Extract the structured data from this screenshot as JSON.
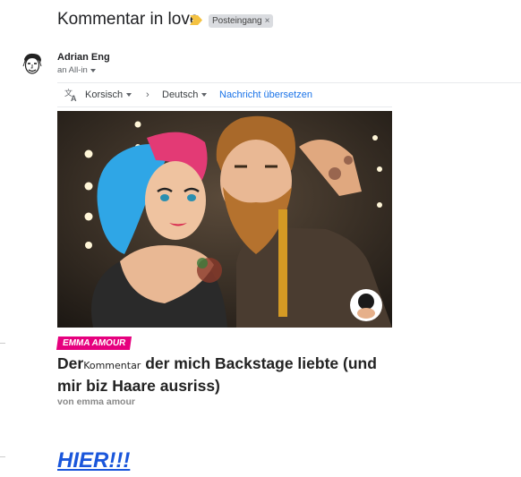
{
  "header": {
    "subject": "Kommentar in love",
    "importance_icon": "importance-marker-icon",
    "label": "Posteingang",
    "label_remove": "×"
  },
  "message": {
    "sender": "Adrian Eng",
    "recipient": "an All-in",
    "avatar_icon": "face-sketch-avatar"
  },
  "translate_bar": {
    "icon": "translate-icon",
    "source_lang": "Korsisch",
    "arrow": "›",
    "target_lang": "Deutsch",
    "action": "Nachricht übersetzen"
  },
  "article": {
    "image_desc_icon": "pinup-couple-illustration",
    "badge": "EMMA AMOUR",
    "headline_part1": "Der",
    "headline_small": "Kommentar",
    "headline_part2": " der mich Backstage liebte (und mir biz Haare ausriss)",
    "byline": "von emma amour",
    "cta": "HIER!!!"
  },
  "colors": {
    "badge": "#e6007e",
    "link": "#1a73e8",
    "cta": "#1a56db",
    "importance": "#f4c242"
  }
}
